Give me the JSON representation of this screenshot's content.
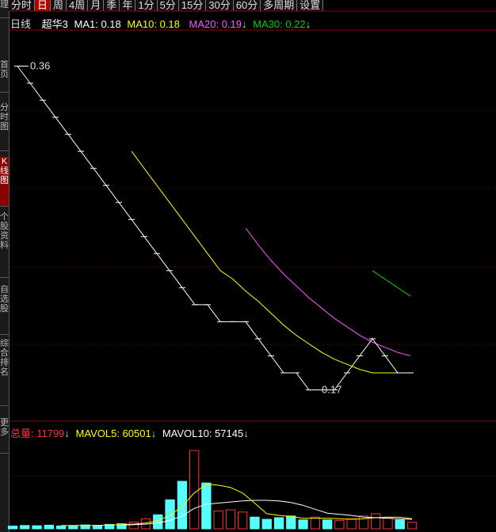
{
  "period_tabs": [
    {
      "label": "分时",
      "active": false
    },
    {
      "label": "日",
      "active": true
    },
    {
      "label": "周",
      "active": false
    },
    {
      "label": "4周",
      "active": false
    },
    {
      "label": "月",
      "active": false
    },
    {
      "label": "季",
      "active": false
    },
    {
      "label": "年",
      "active": false
    },
    {
      "label": "1分",
      "active": false
    },
    {
      "label": "5分",
      "active": false
    },
    {
      "label": "15分",
      "active": false
    },
    {
      "label": "30分",
      "active": false
    },
    {
      "label": "60分",
      "active": false
    },
    {
      "label": "多周期",
      "active": false
    },
    {
      "label": "设置",
      "active": false
    }
  ],
  "sidebar_tabs": [
    {
      "label": "理",
      "active": false
    },
    {
      "label": "首页",
      "active": false
    },
    {
      "label": "分时图",
      "active": false
    },
    {
      "label": "K线图",
      "active": true
    },
    {
      "label": "个股资料",
      "active": false
    },
    {
      "label": "自选股",
      "active": false
    },
    {
      "label": "综合排名",
      "active": false
    },
    {
      "label": "更多",
      "active": false
    }
  ],
  "header": {
    "period": "日线",
    "stock_name": "超华3",
    "ma1": "MA1: 0.18",
    "ma10": "MA10: 0.18",
    "ma20": "MA20: 0.19",
    "ma30": "MA30: 0.22",
    "arrow": "↓"
  },
  "volume_header": {
    "vol": "总量: 11799",
    "mavol5": "MAVOL5: 60501",
    "mavol10": "MAVOL10: 57145",
    "arrow": "↓"
  },
  "colors": {
    "ma1": "#ffffff",
    "ma10": "#ffff00",
    "ma20": "#ff55ff",
    "ma30": "#00cc00",
    "up": "#ff3333",
    "down": "#55ffff",
    "grid": "#7a0000",
    "vol_header": "#ff3333"
  },
  "chart_data": {
    "type": "line",
    "price_labels": {
      "high": "0.36",
      "low": "0.17"
    },
    "price_range": [
      0.16,
      0.37
    ],
    "ma1": [
      0.36,
      0.35,
      0.34,
      0.33,
      0.32,
      0.31,
      0.3,
      0.29,
      0.28,
      0.27,
      0.26,
      0.25,
      0.24,
      0.23,
      0.22,
      0.22,
      0.21,
      0.21,
      0.21,
      0.2,
      0.19,
      0.18,
      0.18,
      0.17,
      0.17,
      0.17,
      0.18,
      0.19,
      0.2,
      0.19,
      0.18,
      0.18
    ],
    "ma10": [
      null,
      null,
      null,
      null,
      null,
      null,
      null,
      null,
      null,
      0.31,
      0.3,
      0.29,
      0.28,
      0.27,
      0.26,
      0.25,
      0.24,
      0.235,
      0.228,
      0.222,
      0.215,
      0.208,
      0.202,
      0.197,
      0.192,
      0.188,
      0.185,
      0.182,
      0.18,
      0.18,
      0.18,
      0.18
    ],
    "ma20": [
      null,
      null,
      null,
      null,
      null,
      null,
      null,
      null,
      null,
      null,
      null,
      null,
      null,
      null,
      null,
      null,
      null,
      null,
      0.265,
      0.255,
      0.246,
      0.238,
      0.231,
      0.224,
      0.218,
      0.212,
      0.207,
      0.202,
      0.198,
      0.195,
      0.192,
      0.19
    ],
    "ma30": [
      null,
      null,
      null,
      null,
      null,
      null,
      null,
      null,
      null,
      null,
      null,
      null,
      null,
      null,
      null,
      null,
      null,
      null,
      null,
      null,
      null,
      null,
      null,
      null,
      null,
      null,
      null,
      null,
      0.24,
      0.235,
      0.23,
      0.225
    ],
    "volume": [
      5000,
      6000,
      5500,
      6500,
      5200,
      5800,
      7000,
      6200,
      8000,
      9000,
      12000,
      18000,
      25000,
      52000,
      85000,
      140000,
      82000,
      32000,
      34000,
      30000,
      21000,
      17000,
      20000,
      23000,
      16000,
      21000,
      16000,
      15000,
      18000,
      23000,
      27000,
      20000,
      16000,
      11799
    ],
    "volume_up": [
      false,
      false,
      false,
      false,
      false,
      false,
      false,
      false,
      false,
      false,
      true,
      true,
      false,
      false,
      false,
      true,
      false,
      true,
      true,
      true,
      false,
      false,
      false,
      false,
      false,
      true,
      false,
      true,
      true,
      true,
      true,
      true,
      false,
      true
    ],
    "mavol5": [
      null,
      null,
      null,
      null,
      6000,
      6000,
      6100,
      6300,
      6600,
      7300,
      8500,
      10500,
      14500,
      24000,
      40000,
      64000,
      80000,
      78000,
      74000,
      64000,
      46000,
      27000,
      24000,
      22000,
      19000,
      19000,
      19000,
      18000,
      17000,
      18000,
      20000,
      21000,
      21000,
      18000
    ],
    "mavol10": [
      null,
      null,
      null,
      null,
      null,
      null,
      null,
      null,
      null,
      6600,
      7300,
      8500,
      10500,
      15000,
      23000,
      36500,
      44000,
      46000,
      48000,
      50000,
      51000,
      51000,
      50000,
      47000,
      42000,
      35000,
      28000,
      26000,
      24000,
      21000,
      20000,
      19000,
      18000,
      17000
    ],
    "volume_range": [
      0,
      160000
    ]
  }
}
